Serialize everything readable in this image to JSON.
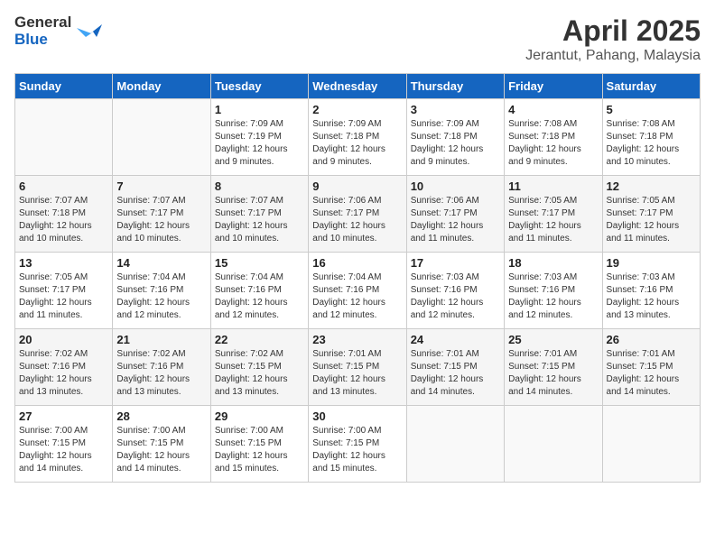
{
  "logo": {
    "general": "General",
    "blue": "Blue"
  },
  "title": "April 2025",
  "subtitle": "Jerantut, Pahang, Malaysia",
  "days_header": [
    "Sunday",
    "Monday",
    "Tuesday",
    "Wednesday",
    "Thursday",
    "Friday",
    "Saturday"
  ],
  "weeks": [
    [
      {
        "day": "",
        "info": ""
      },
      {
        "day": "",
        "info": ""
      },
      {
        "day": "1",
        "info": "Sunrise: 7:09 AM\nSunset: 7:19 PM\nDaylight: 12 hours and 9 minutes."
      },
      {
        "day": "2",
        "info": "Sunrise: 7:09 AM\nSunset: 7:18 PM\nDaylight: 12 hours and 9 minutes."
      },
      {
        "day": "3",
        "info": "Sunrise: 7:09 AM\nSunset: 7:18 PM\nDaylight: 12 hours and 9 minutes."
      },
      {
        "day": "4",
        "info": "Sunrise: 7:08 AM\nSunset: 7:18 PM\nDaylight: 12 hours and 9 minutes."
      },
      {
        "day": "5",
        "info": "Sunrise: 7:08 AM\nSunset: 7:18 PM\nDaylight: 12 hours and 10 minutes."
      }
    ],
    [
      {
        "day": "6",
        "info": "Sunrise: 7:07 AM\nSunset: 7:18 PM\nDaylight: 12 hours and 10 minutes."
      },
      {
        "day": "7",
        "info": "Sunrise: 7:07 AM\nSunset: 7:17 PM\nDaylight: 12 hours and 10 minutes."
      },
      {
        "day": "8",
        "info": "Sunrise: 7:07 AM\nSunset: 7:17 PM\nDaylight: 12 hours and 10 minutes."
      },
      {
        "day": "9",
        "info": "Sunrise: 7:06 AM\nSunset: 7:17 PM\nDaylight: 12 hours and 10 minutes."
      },
      {
        "day": "10",
        "info": "Sunrise: 7:06 AM\nSunset: 7:17 PM\nDaylight: 12 hours and 11 minutes."
      },
      {
        "day": "11",
        "info": "Sunrise: 7:05 AM\nSunset: 7:17 PM\nDaylight: 12 hours and 11 minutes."
      },
      {
        "day": "12",
        "info": "Sunrise: 7:05 AM\nSunset: 7:17 PM\nDaylight: 12 hours and 11 minutes."
      }
    ],
    [
      {
        "day": "13",
        "info": "Sunrise: 7:05 AM\nSunset: 7:17 PM\nDaylight: 12 hours and 11 minutes."
      },
      {
        "day": "14",
        "info": "Sunrise: 7:04 AM\nSunset: 7:16 PM\nDaylight: 12 hours and 12 minutes."
      },
      {
        "day": "15",
        "info": "Sunrise: 7:04 AM\nSunset: 7:16 PM\nDaylight: 12 hours and 12 minutes."
      },
      {
        "day": "16",
        "info": "Sunrise: 7:04 AM\nSunset: 7:16 PM\nDaylight: 12 hours and 12 minutes."
      },
      {
        "day": "17",
        "info": "Sunrise: 7:03 AM\nSunset: 7:16 PM\nDaylight: 12 hours and 12 minutes."
      },
      {
        "day": "18",
        "info": "Sunrise: 7:03 AM\nSunset: 7:16 PM\nDaylight: 12 hours and 12 minutes."
      },
      {
        "day": "19",
        "info": "Sunrise: 7:03 AM\nSunset: 7:16 PM\nDaylight: 12 hours and 13 minutes."
      }
    ],
    [
      {
        "day": "20",
        "info": "Sunrise: 7:02 AM\nSunset: 7:16 PM\nDaylight: 12 hours and 13 minutes."
      },
      {
        "day": "21",
        "info": "Sunrise: 7:02 AM\nSunset: 7:16 PM\nDaylight: 12 hours and 13 minutes."
      },
      {
        "day": "22",
        "info": "Sunrise: 7:02 AM\nSunset: 7:15 PM\nDaylight: 12 hours and 13 minutes."
      },
      {
        "day": "23",
        "info": "Sunrise: 7:01 AM\nSunset: 7:15 PM\nDaylight: 12 hours and 13 minutes."
      },
      {
        "day": "24",
        "info": "Sunrise: 7:01 AM\nSunset: 7:15 PM\nDaylight: 12 hours and 14 minutes."
      },
      {
        "day": "25",
        "info": "Sunrise: 7:01 AM\nSunset: 7:15 PM\nDaylight: 12 hours and 14 minutes."
      },
      {
        "day": "26",
        "info": "Sunrise: 7:01 AM\nSunset: 7:15 PM\nDaylight: 12 hours and 14 minutes."
      }
    ],
    [
      {
        "day": "27",
        "info": "Sunrise: 7:00 AM\nSunset: 7:15 PM\nDaylight: 12 hours and 14 minutes."
      },
      {
        "day": "28",
        "info": "Sunrise: 7:00 AM\nSunset: 7:15 PM\nDaylight: 12 hours and 14 minutes."
      },
      {
        "day": "29",
        "info": "Sunrise: 7:00 AM\nSunset: 7:15 PM\nDaylight: 12 hours and 15 minutes."
      },
      {
        "day": "30",
        "info": "Sunrise: 7:00 AM\nSunset: 7:15 PM\nDaylight: 12 hours and 15 minutes."
      },
      {
        "day": "",
        "info": ""
      },
      {
        "day": "",
        "info": ""
      },
      {
        "day": "",
        "info": ""
      }
    ]
  ]
}
